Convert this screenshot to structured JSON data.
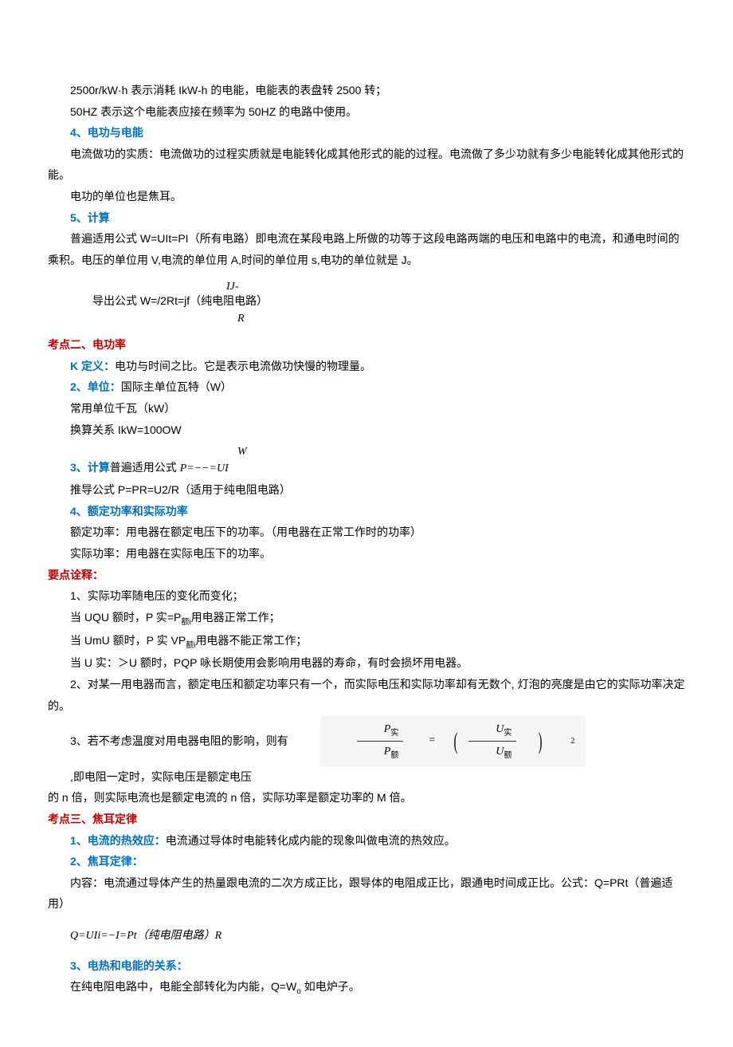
{
  "p1": "2500r/kW·h 表示消耗 IkW-h 的电能，电能表的表盘转 2500 转；",
  "p2": "50HZ 表示这个电能表应接在频率为 50HZ 的电路中使用。",
  "h4": "4、电功与电能",
  "p3": "电流做功的实质：电流做功的过程实质就是电能转化成其他形式的能的过程。电流做了多少功就有多少电能转化成其他形式的能。",
  "p4": "电功的单位也是焦耳。",
  "h5": "5、计算",
  "p5": "普遍适用公式 W=UIt=PI（所有电路）即电流在某段电路上所做的功等于这段电路两端的电压和电路中的电流，和通电时间的乘积。电压的单位用 V,电流的单位用 A,时间的单位用 s,电功的单位就是 J。",
  "p6a": "导出公式 W=/2Rt=jf（纯电阻电路）",
  "p6num": "IJ-",
  "p6den": "R",
  "sec2": "考点二、电功率",
  "s2_1": "K 定义：",
  "s2_1t": "电功与时间之比。它是表示电流做功快慢的物理量。",
  "s2_2": "2、单位：",
  "s2_2t": "国际主单位瓦特（W）",
  "s2_2a": "常用单位千瓦（kW）",
  "s2_2b": "换算关系 IkW=100OW",
  "s2_3": "3、计算",
  "s2_3t": "普遍适用公式 ",
  "s2_3f": "P=−−=UI",
  "s2_3num": "W",
  "s2_3b": "推导公式 P=PR=U2/R（适用于纯电阻电路）",
  "s2_4": "4、额定功率和实际功率",
  "s2_4a": "额定功率：用电器在额定电压下的功率。（用电器在正常工作时的功率）",
  "s2_4b": "实际功率：用电器在实际电压下的功率。",
  "yd": "要点诠释：",
  "yd1": "1、实际功率随电压的变化而变化；",
  "yd1a_pre": "当 UQU 额时，P 实=P",
  "yd1a_sub": "额i",
  "yd1a_post": "用电器正常工作；",
  "yd1b_pre": "当 UmU 额时，P 实 VP",
  "yd1b_sub": "额i",
  "yd1b_post": "用电器不能正常工作；",
  "yd1c": "当 U 实：＞U 额时，PQP 咏长期使用会影响用电器的寿命，有时会损坏用电器。",
  "yd2": "2、对某一用电器而言，额定电压和额定功率只有一个，而实际电压和实际功率却有无数个, 灯泡的亮度是由它的实际功率决定的。",
  "yd3a": "3、若不考虑温度对用电器电阻的影响，则有",
  "yd3b": ",即电阻一定时，实际电压是额定电压",
  "yd3c": "的 n 倍，则实际电流也是额定电流的 n 倍，实际功率是额定功率的 M 倍。",
  "ratio_P": "P",
  "ratio_shi": "实",
  "ratio_e": "额",
  "ratio_U": "U",
  "ratio_exp": "2",
  "sec3": "考点三、焦耳定律",
  "s3_1": "1、电流的热效应：",
  "s3_1t": "电流通过导体时电能转化成内能的现象叫做电流的热效应。",
  "s3_2": "2、焦耳定律：",
  "s3_2a": "内容：电流通过导体产生的热量跟电流的二次方成正比，跟导体的电阻成正比，跟通电时间成正比。公式：Q=PRt（普遍适用）",
  "s3_2b": "Q=UIi=−I=Pt（纯电阻电路）R",
  "s3_3": "3、电热和电能的关系：",
  "s3_3a_pre": "在纯电阻电路中，电能全部转化为内能，Q=W",
  "s3_3a_sub": "o",
  "s3_3a_post": " 如电炉子。"
}
